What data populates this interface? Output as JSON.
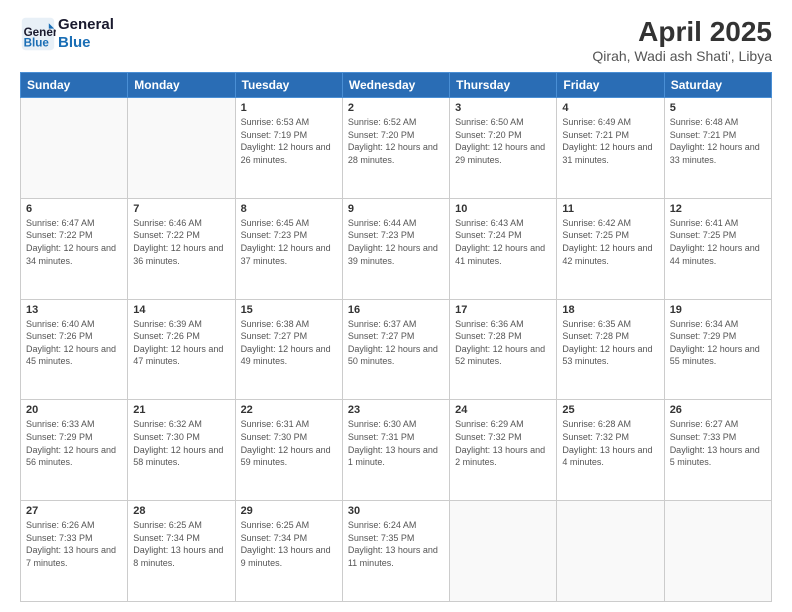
{
  "logo": {
    "line1": "General",
    "line2": "Blue"
  },
  "header": {
    "title": "April 2025",
    "subtitle": "Qirah, Wadi ash Shati', Libya"
  },
  "days_of_week": [
    "Sunday",
    "Monday",
    "Tuesday",
    "Wednesday",
    "Thursday",
    "Friday",
    "Saturday"
  ],
  "weeks": [
    [
      {
        "day": "",
        "info": ""
      },
      {
        "day": "",
        "info": ""
      },
      {
        "day": "1",
        "info": "Sunrise: 6:53 AM\nSunset: 7:19 PM\nDaylight: 12 hours and 26 minutes."
      },
      {
        "day": "2",
        "info": "Sunrise: 6:52 AM\nSunset: 7:20 PM\nDaylight: 12 hours and 28 minutes."
      },
      {
        "day": "3",
        "info": "Sunrise: 6:50 AM\nSunset: 7:20 PM\nDaylight: 12 hours and 29 minutes."
      },
      {
        "day": "4",
        "info": "Sunrise: 6:49 AM\nSunset: 7:21 PM\nDaylight: 12 hours and 31 minutes."
      },
      {
        "day": "5",
        "info": "Sunrise: 6:48 AM\nSunset: 7:21 PM\nDaylight: 12 hours and 33 minutes."
      }
    ],
    [
      {
        "day": "6",
        "info": "Sunrise: 6:47 AM\nSunset: 7:22 PM\nDaylight: 12 hours and 34 minutes."
      },
      {
        "day": "7",
        "info": "Sunrise: 6:46 AM\nSunset: 7:22 PM\nDaylight: 12 hours and 36 minutes."
      },
      {
        "day": "8",
        "info": "Sunrise: 6:45 AM\nSunset: 7:23 PM\nDaylight: 12 hours and 37 minutes."
      },
      {
        "day": "9",
        "info": "Sunrise: 6:44 AM\nSunset: 7:23 PM\nDaylight: 12 hours and 39 minutes."
      },
      {
        "day": "10",
        "info": "Sunrise: 6:43 AM\nSunset: 7:24 PM\nDaylight: 12 hours and 41 minutes."
      },
      {
        "day": "11",
        "info": "Sunrise: 6:42 AM\nSunset: 7:25 PM\nDaylight: 12 hours and 42 minutes."
      },
      {
        "day": "12",
        "info": "Sunrise: 6:41 AM\nSunset: 7:25 PM\nDaylight: 12 hours and 44 minutes."
      }
    ],
    [
      {
        "day": "13",
        "info": "Sunrise: 6:40 AM\nSunset: 7:26 PM\nDaylight: 12 hours and 45 minutes."
      },
      {
        "day": "14",
        "info": "Sunrise: 6:39 AM\nSunset: 7:26 PM\nDaylight: 12 hours and 47 minutes."
      },
      {
        "day": "15",
        "info": "Sunrise: 6:38 AM\nSunset: 7:27 PM\nDaylight: 12 hours and 49 minutes."
      },
      {
        "day": "16",
        "info": "Sunrise: 6:37 AM\nSunset: 7:27 PM\nDaylight: 12 hours and 50 minutes."
      },
      {
        "day": "17",
        "info": "Sunrise: 6:36 AM\nSunset: 7:28 PM\nDaylight: 12 hours and 52 minutes."
      },
      {
        "day": "18",
        "info": "Sunrise: 6:35 AM\nSunset: 7:28 PM\nDaylight: 12 hours and 53 minutes."
      },
      {
        "day": "19",
        "info": "Sunrise: 6:34 AM\nSunset: 7:29 PM\nDaylight: 12 hours and 55 minutes."
      }
    ],
    [
      {
        "day": "20",
        "info": "Sunrise: 6:33 AM\nSunset: 7:29 PM\nDaylight: 12 hours and 56 minutes."
      },
      {
        "day": "21",
        "info": "Sunrise: 6:32 AM\nSunset: 7:30 PM\nDaylight: 12 hours and 58 minutes."
      },
      {
        "day": "22",
        "info": "Sunrise: 6:31 AM\nSunset: 7:30 PM\nDaylight: 12 hours and 59 minutes."
      },
      {
        "day": "23",
        "info": "Sunrise: 6:30 AM\nSunset: 7:31 PM\nDaylight: 13 hours and 1 minute."
      },
      {
        "day": "24",
        "info": "Sunrise: 6:29 AM\nSunset: 7:32 PM\nDaylight: 13 hours and 2 minutes."
      },
      {
        "day": "25",
        "info": "Sunrise: 6:28 AM\nSunset: 7:32 PM\nDaylight: 13 hours and 4 minutes."
      },
      {
        "day": "26",
        "info": "Sunrise: 6:27 AM\nSunset: 7:33 PM\nDaylight: 13 hours and 5 minutes."
      }
    ],
    [
      {
        "day": "27",
        "info": "Sunrise: 6:26 AM\nSunset: 7:33 PM\nDaylight: 13 hours and 7 minutes."
      },
      {
        "day": "28",
        "info": "Sunrise: 6:25 AM\nSunset: 7:34 PM\nDaylight: 13 hours and 8 minutes."
      },
      {
        "day": "29",
        "info": "Sunrise: 6:25 AM\nSunset: 7:34 PM\nDaylight: 13 hours and 9 minutes."
      },
      {
        "day": "30",
        "info": "Sunrise: 6:24 AM\nSunset: 7:35 PM\nDaylight: 13 hours and 11 minutes."
      },
      {
        "day": "",
        "info": ""
      },
      {
        "day": "",
        "info": ""
      },
      {
        "day": "",
        "info": ""
      }
    ]
  ]
}
